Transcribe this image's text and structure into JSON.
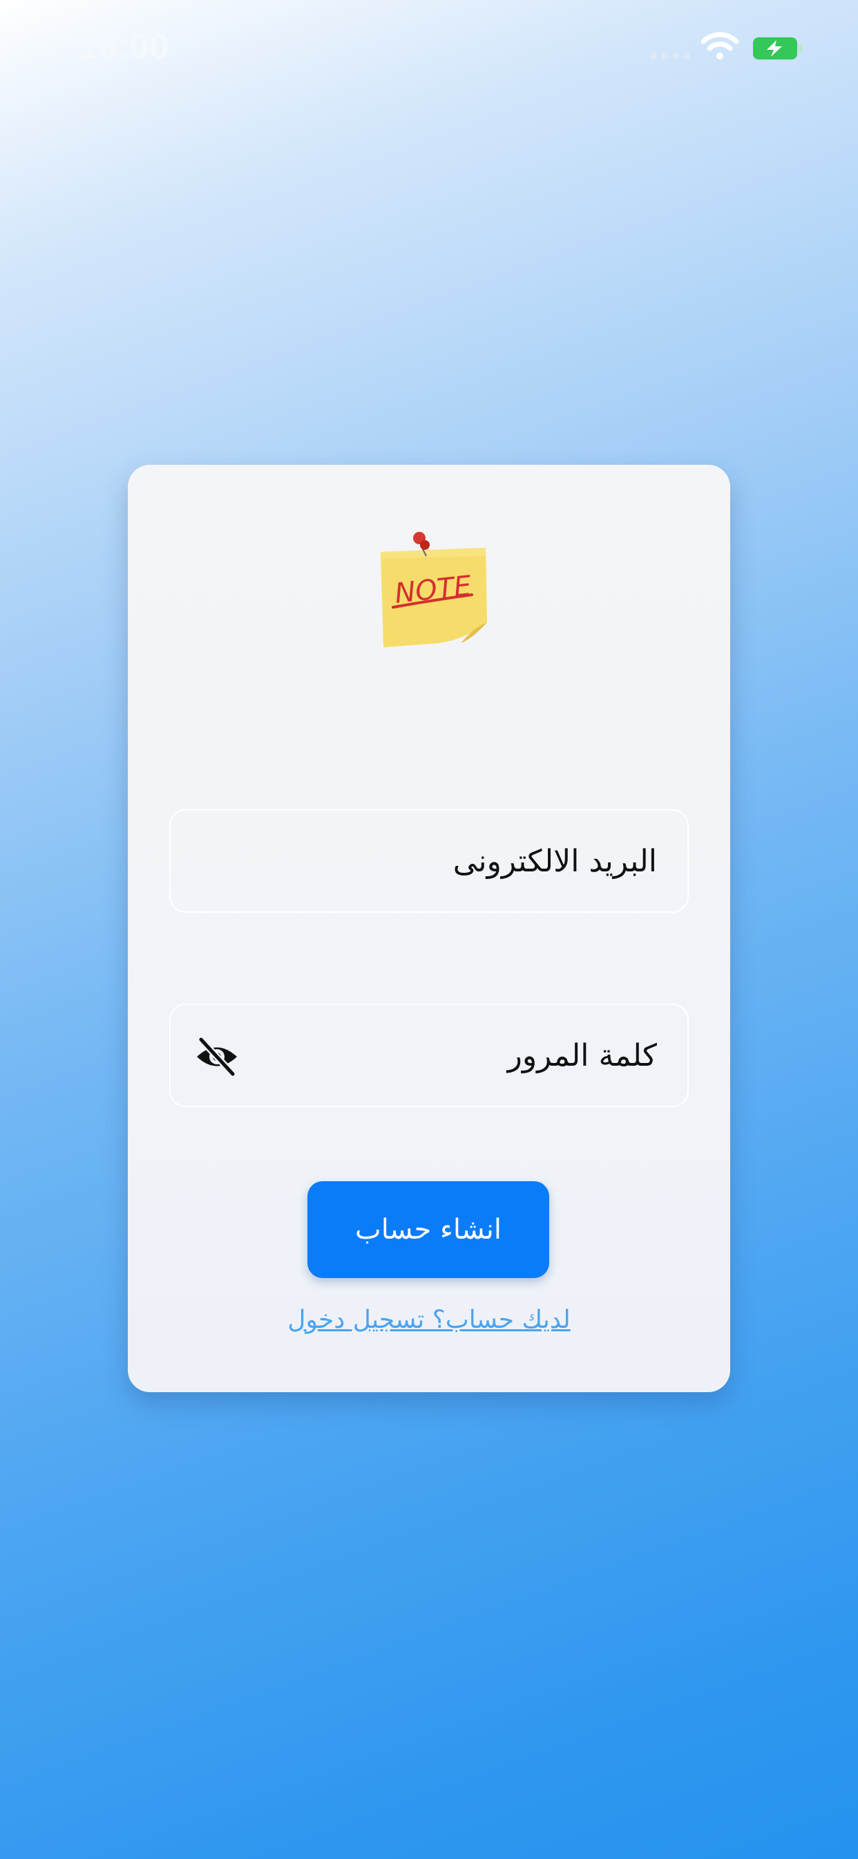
{
  "status_bar": {
    "time": "16:00",
    "icons": [
      "signal-dots-icon",
      "wifi-icon",
      "battery-charging-icon"
    ]
  },
  "logo": {
    "icon": "sticky-note-icon",
    "text": "NOTE"
  },
  "form": {
    "email_placeholder": "البريد الالكترونى",
    "password_placeholder": "كلمة المرور",
    "password_toggle_icon": "eye-off-icon",
    "submit_label": "انشاء حساب",
    "login_link": "لديك حساب؟ تسجيل دخول"
  },
  "colors": {
    "primary": "#0a7cf7",
    "link": "#4ba3ee",
    "battery": "#34c759",
    "note_yellow": "#f6dc6a",
    "note_text": "#d32f2f"
  }
}
